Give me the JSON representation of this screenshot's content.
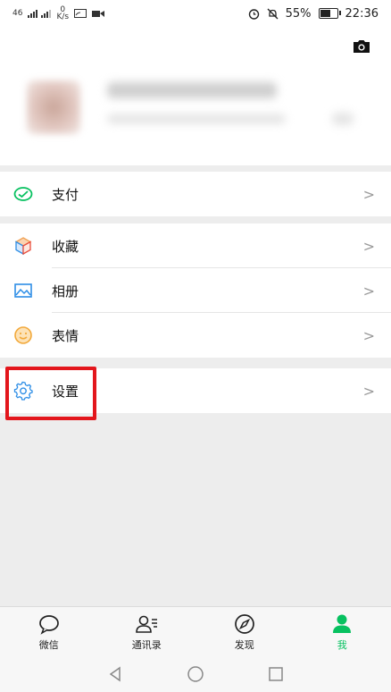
{
  "status_bar": {
    "signal_text": "46",
    "net_speed_top": "0",
    "net_speed_unit": "K/s",
    "battery_percent": "55%",
    "time": "22:36"
  },
  "profile": {
    "camera_icon": "camera-icon"
  },
  "menu": {
    "pay": {
      "label": "支付",
      "icon": "wallet-icon"
    },
    "favorites": {
      "label": "收藏",
      "icon": "cube-icon"
    },
    "album": {
      "label": "相册",
      "icon": "image-icon"
    },
    "stickers": {
      "label": "表情",
      "icon": "smiley-icon"
    },
    "settings": {
      "label": "设置",
      "icon": "gear-icon"
    }
  },
  "tabbar": {
    "tabs": [
      {
        "label": "微信",
        "icon": "chat-icon",
        "active": false
      },
      {
        "label": "通讯录",
        "icon": "contacts-icon",
        "active": false
      },
      {
        "label": "发现",
        "icon": "compass-icon",
        "active": false
      },
      {
        "label": "我",
        "icon": "person-icon",
        "active": true
      }
    ]
  },
  "colors": {
    "accent_green": "#07c160",
    "highlight_red": "#e3161c",
    "background": "#ededed"
  }
}
